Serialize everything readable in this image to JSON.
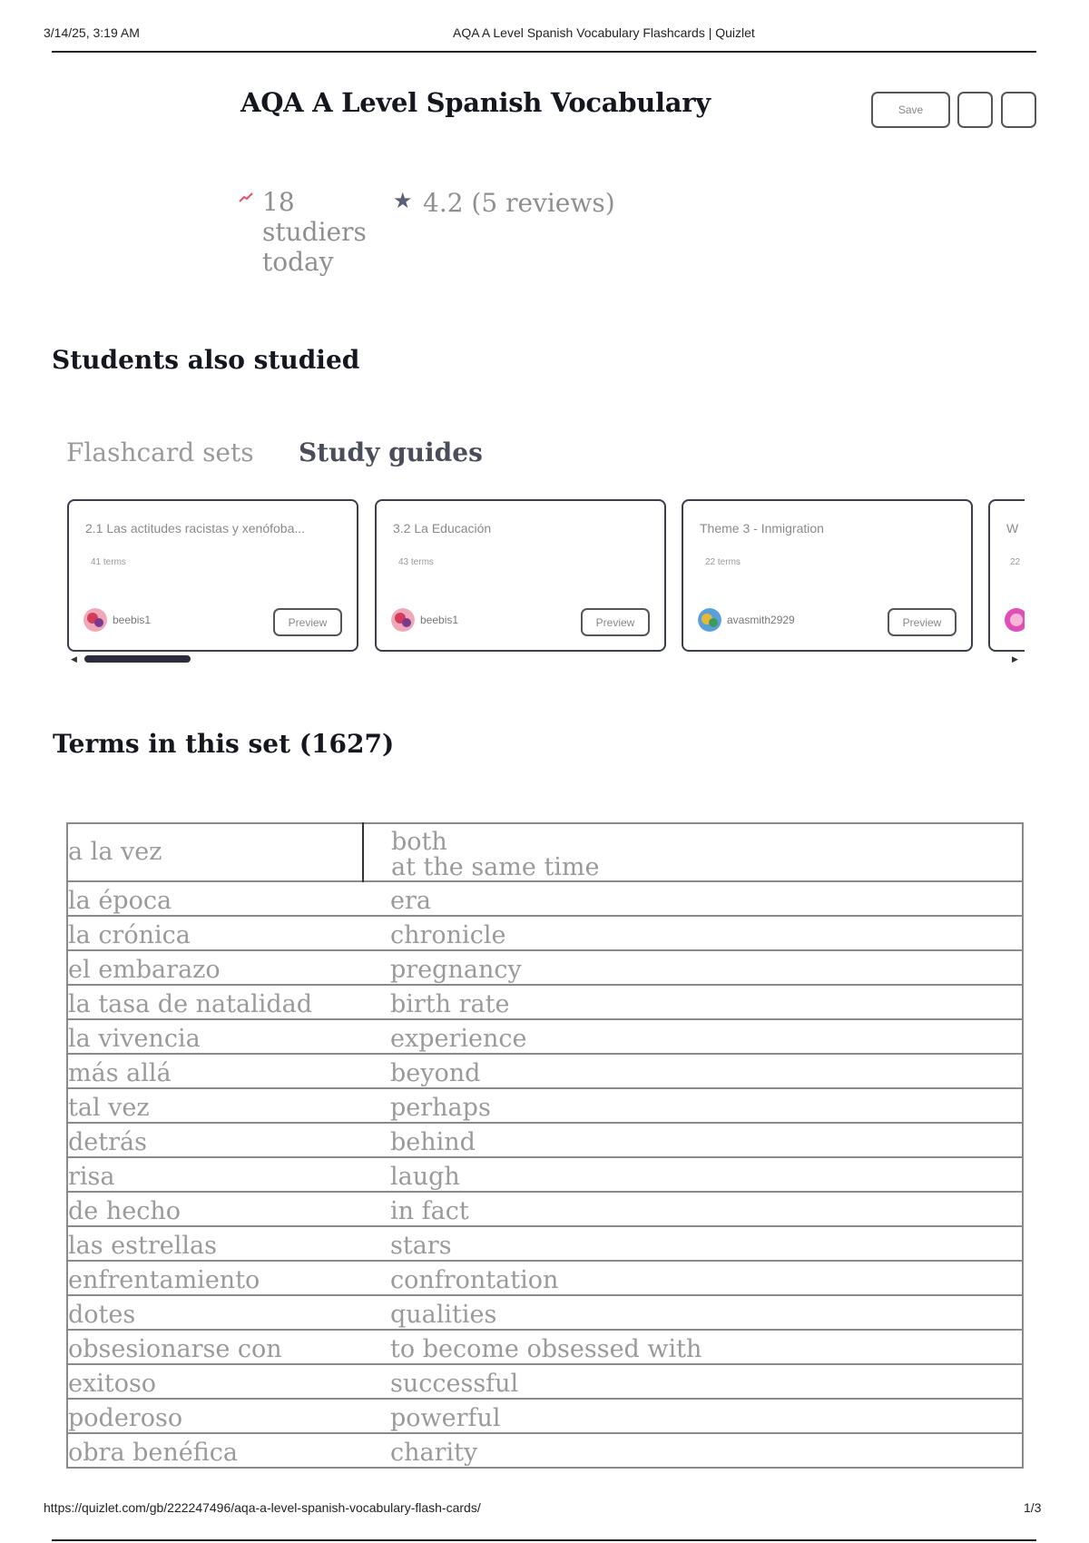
{
  "print_header": {
    "datetime": "3/14/25, 3:19 AM",
    "page_title": "AQA A Level Spanish Vocabulary Flashcards | Quizlet"
  },
  "header": {
    "title": "AQA A Level Spanish Vocabulary",
    "save_label": "Save"
  },
  "stats": {
    "studiers": "18 studiers today",
    "rating": "4.2 (5 reviews)",
    "trend_icon": "trending-up-icon",
    "star_icon": "star-icon"
  },
  "students_also_studied": {
    "title": "Students also studied",
    "tabs": [
      {
        "label": "Flashcard sets",
        "active": false
      },
      {
        "label": "Study guides",
        "active": true
      }
    ],
    "cards": [
      {
        "title": "2.1 Las actitudes racistas y xenófoba...",
        "count": "41 terms",
        "user": "beebis1",
        "preview_label": "Preview"
      },
      {
        "title": "3.2 La Educación",
        "count": "43 terms",
        "user": "beebis1",
        "preview_label": "Preview"
      },
      {
        "title": "Theme 3 - Inmigration",
        "count": "22 terms",
        "user": "avasmith2929",
        "preview_label": "Preview"
      },
      {
        "title": "W",
        "count": "22",
        "user": "",
        "preview_label": ""
      }
    ]
  },
  "terms": {
    "title": "Terms in this set (1627)",
    "rows": [
      {
        "term": "a la vez",
        "definition": "both\nat the same time"
      },
      {
        "term": "la época",
        "definition": "era"
      },
      {
        "term": "la crónica",
        "definition": "chronicle"
      },
      {
        "term": "el embarazo",
        "definition": "pregnancy"
      },
      {
        "term": "la tasa de natalidad",
        "definition": "birth rate"
      },
      {
        "term": "la vivencia",
        "definition": "experience"
      },
      {
        "term": "más allá",
        "definition": "beyond"
      },
      {
        "term": "tal vez",
        "definition": "perhaps"
      },
      {
        "term": "detrás",
        "definition": "behind"
      },
      {
        "term": "risa",
        "definition": "laugh"
      },
      {
        "term": "de hecho",
        "definition": "in fact"
      },
      {
        "term": "las estrellas",
        "definition": "stars"
      },
      {
        "term": "enfrentamiento",
        "definition": "confrontation"
      },
      {
        "term": "dotes",
        "definition": "qualities"
      },
      {
        "term": "obsesionarse con",
        "definition": "to become obsessed with"
      },
      {
        "term": "exitoso",
        "definition": "successful"
      },
      {
        "term": "poderoso",
        "definition": "powerful"
      },
      {
        "term": "obra benéfica",
        "definition": "charity"
      }
    ]
  },
  "print_footer": {
    "url": "https://quizlet.com/gb/222247496/aqa-a-level-spanish-vocabulary-flash-cards/",
    "page": "1/3"
  }
}
